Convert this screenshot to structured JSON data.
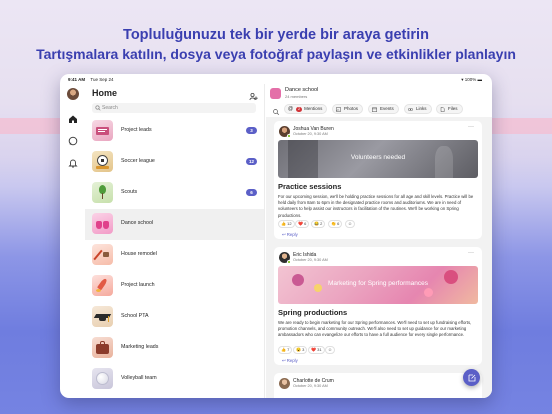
{
  "promo": {
    "line1": "Topluluğunuzu tek bir yerde bir araya getirin",
    "line2": "Tartışmalara katılın, dosya veya fotoğraf paylaşın ve etkinlikler planlayın"
  },
  "status": {
    "time": "9:41 AM",
    "date": "Tue Sep 24",
    "battery": "100%"
  },
  "sidebar": {
    "title": "Home",
    "search_placeholder": "Search",
    "items": [
      {
        "label": "Project leads",
        "badge": "3",
        "thumb": "project-leads-thumb"
      },
      {
        "label": "Soccer league",
        "badge": "12",
        "thumb": "soccer-thumb"
      },
      {
        "label": "Scouts",
        "badge": "6",
        "thumb": "scouts-thumb"
      },
      {
        "label": "Dance school",
        "badge": "",
        "thumb": "dance-thumb"
      },
      {
        "label": "House remodel",
        "badge": "",
        "thumb": "house-thumb"
      },
      {
        "label": "Project launch",
        "badge": "",
        "thumb": "launch-thumb"
      },
      {
        "label": "School PTA",
        "badge": "",
        "thumb": "pta-thumb"
      },
      {
        "label": "Marketing leads",
        "badge": "",
        "thumb": "marketing-thumb"
      },
      {
        "label": "Volleyball team",
        "badge": "",
        "thumb": "volleyball-thumb"
      }
    ]
  },
  "header": {
    "title": "Dance school",
    "subtitle": "24 members"
  },
  "tabs": [
    {
      "label": "Mentions",
      "count": "2",
      "icon": "at-icon"
    },
    {
      "label": "Photos",
      "icon": "photo-icon"
    },
    {
      "label": "Events",
      "icon": "calendar-icon"
    },
    {
      "label": "Links",
      "icon": "link-icon"
    },
    {
      "label": "Files",
      "icon": "file-icon"
    }
  ],
  "posts": [
    {
      "author": "Joshua Van Buren",
      "date": "October 20, 9:30 AM",
      "banner": "Volunteers needed",
      "title": "Practice sessions",
      "body": "For our upcoming session, we'll be holding practice sessions for all age and skill levels. Practice will be held daily from 8am to 6pm in the designated practice rooms and auditoriums. We are in need of volunteers to help assist our instructors in facilitation of the routines. We'll be working on Spring productions.",
      "reactions": [
        "👍 12",
        "❤️ 6",
        "😂 2",
        "👏 6"
      ],
      "reply": "Reply"
    },
    {
      "author": "Eric Ishida",
      "date": "October 20, 9:30 AM",
      "banner": "Marketing for Spring performances",
      "title": "Spring productions",
      "body": "We are ready to begin marketing for our Spring performances. We'll need to set up fundraising efforts, promotion channels, and community outreach. We'll also need to set up guidance for our marketing ambassadors who can evangelize our efforts to have a full audience for every single performance.",
      "reactions": [
        "👍 7",
        "😮 3",
        "❤️ 31"
      ],
      "reply": "Reply"
    },
    {
      "author": "Charlotte de Crum",
      "date": "October 20, 9:30 AM"
    }
  ],
  "colors": {
    "accent": "#5b5fc7",
    "mention_badge": "#d13438",
    "presence": "#6bb700"
  }
}
